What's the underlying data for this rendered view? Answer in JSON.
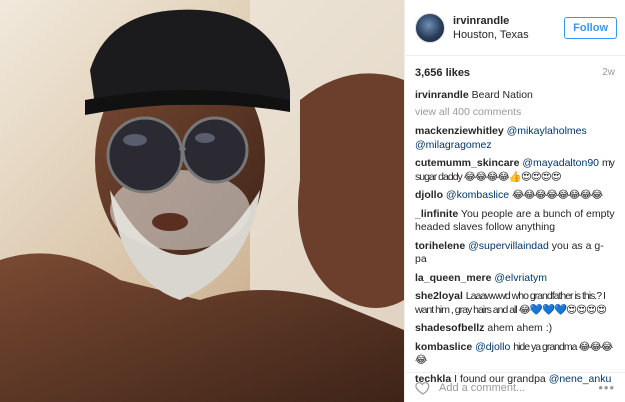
{
  "post": {
    "photo_alt": "Selfie photo",
    "header": {
      "username": "irvinrandle",
      "location": "Houston, Texas",
      "follow_label": "Follow"
    },
    "likes": "3,656 likes",
    "time_ago": "2w",
    "caption": {
      "user": "irvinrandle",
      "text": "Beard Nation"
    },
    "view_all": "view all 400 comments",
    "comments": [
      {
        "user": "mackenziewhitley",
        "mentions": [
          "@mikaylaholmes",
          "@milagragomez"
        ],
        "text": ""
      },
      {
        "user": "cutemumm_skincare",
        "mentions": [
          "@mayadalton90"
        ],
        "text": "my sugar daddy 😂😂😂😂👍😍😍😍😍"
      },
      {
        "user": "djollo",
        "mentions": [
          "@kombaslice"
        ],
        "text": "😂😂😂😂😂😂😂😂"
      },
      {
        "user": "_linfinite",
        "mentions": [],
        "text": "You people are a bunch of empty headed slaves follow anything"
      },
      {
        "user": "torihelene",
        "mentions": [
          "@supervillaindad"
        ],
        "text": "you as a g-pa"
      },
      {
        "user": "la_queen_mere",
        "mentions": [
          "@elvriatym"
        ],
        "text": ""
      },
      {
        "user": "she2loyal",
        "mentions": [],
        "text": "Laaawwwd who grandfather is this.? I want him , gray hairs and all 😂💙💙💙😍😍😍😍"
      },
      {
        "user": "shadesofbellz",
        "mentions": [],
        "text": "ahem ahem :)"
      },
      {
        "user": "kombaslice",
        "mentions": [
          "@djollo"
        ],
        "text": "hide ya grandma 😂😂😂😂"
      },
      {
        "user": "techkla",
        "mentions": [
          "@nene_anku"
        ],
        "text": "I found our grandpa"
      }
    ],
    "add_comment_placeholder": "Add a comment...",
    "more_label": "•••"
  },
  "colors": {
    "link": "#003569",
    "follow_blue": "#3897f0",
    "muted": "#999999"
  }
}
